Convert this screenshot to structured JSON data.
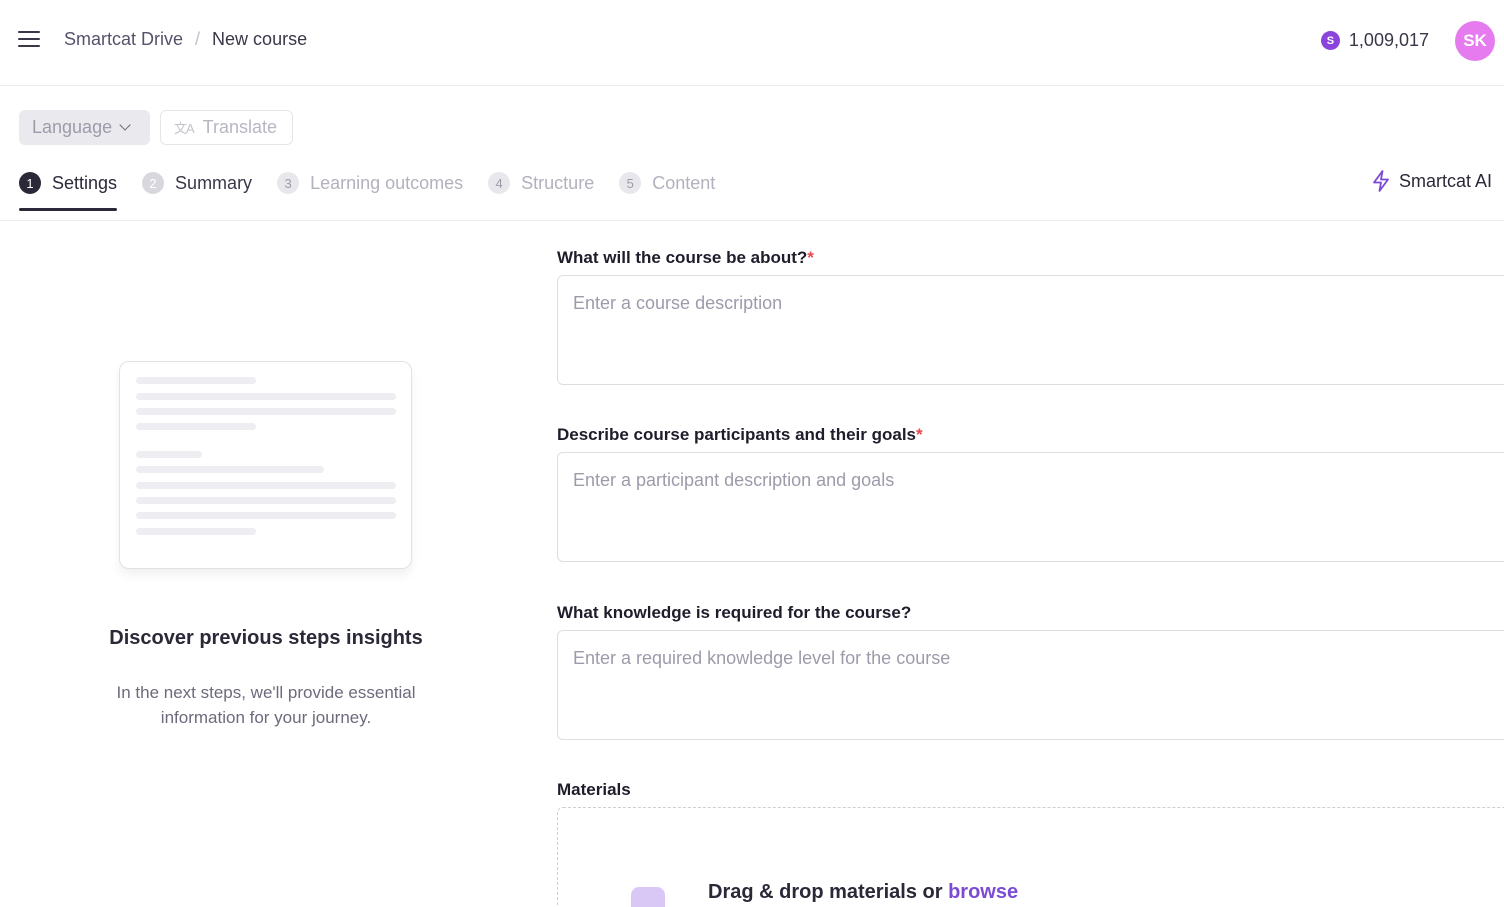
{
  "header": {
    "breadcrumb": [
      "Smartcat Drive",
      "New course"
    ],
    "separator": "/",
    "balance": "1,009,017",
    "coin_symbol": "S",
    "avatar_initials": "SK"
  },
  "toolbar": {
    "language_label": "Language",
    "translate_label": "Translate"
  },
  "steps": [
    {
      "num": "1",
      "label": "Settings",
      "state": "active"
    },
    {
      "num": "2",
      "label": "Summary",
      "state": "enabled"
    },
    {
      "num": "3",
      "label": "Learning outcomes",
      "state": "disabled"
    },
    {
      "num": "4",
      "label": "Structure",
      "state": "disabled"
    },
    {
      "num": "5",
      "label": "Content",
      "state": "disabled"
    }
  ],
  "ai_button_label": "Smartcat AI",
  "insights": {
    "title": "Discover previous steps insights",
    "text": "In the next steps, we'll provide essential information for your journey."
  },
  "form": {
    "about_label": "What will the course be about?",
    "about_placeholder": "Enter a course description",
    "participants_label": "Describe course participants and their goals",
    "participants_placeholder": "Enter a participant description and goals",
    "knowledge_label": "What knowledge is required for the course?",
    "knowledge_placeholder": "Enter a required knowledge level for the course",
    "required_mark": "*",
    "materials_label": "Materials",
    "drop_text": "Drag & drop materials or ",
    "browse_label": "browse"
  },
  "colors": {
    "accent": "#7b4bd6",
    "avatar": "#e67bf0",
    "coin": "#8a44dc",
    "required": "#e5484d"
  }
}
